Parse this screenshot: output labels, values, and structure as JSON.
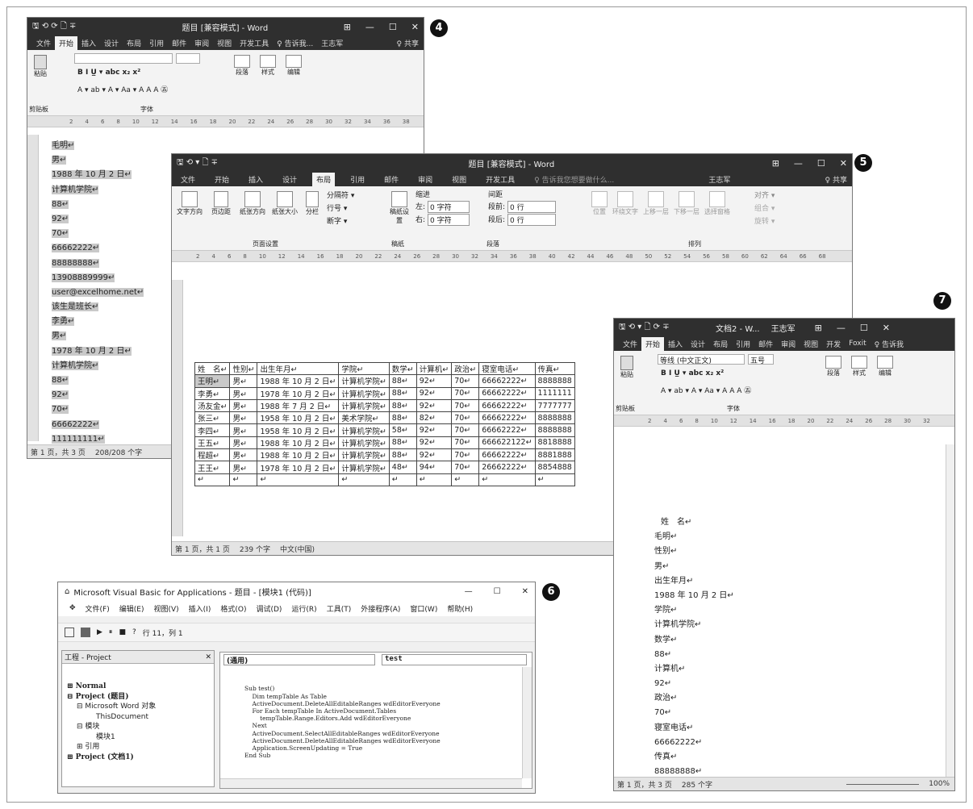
{
  "badges": {
    "b4": "4",
    "b5": "5",
    "b6": "6",
    "b7": "7"
  },
  "win4": {
    "qat": "🖫 ⟲ ⟳ 🗋 ∓",
    "title": "题目 [兼容模式] - Word",
    "controls": [
      "⊞",
      "—",
      "☐",
      "✕"
    ],
    "tabs": [
      "文件",
      "开始",
      "插入",
      "设计",
      "布局",
      "引用",
      "邮件",
      "审阅",
      "视图",
      "开发工具"
    ],
    "tell": "♀ 告诉我...",
    "user": "王志军",
    "share": "♀ 共享",
    "paste": "粘贴",
    "font_row": "B  I  U̲ ▾ abc  x₂  x²",
    "font_row2": "A ▾ ab ▾ A ▾ Aa ▾  A  A  A  ㊄",
    "para": "段落",
    "styles": "样式",
    "edit": "编辑",
    "clipboard": "剪贴板",
    "font": "字体",
    "ruler": [
      "2",
      "4",
      "6",
      "8",
      "10",
      "12",
      "14",
      "16",
      "18",
      "20",
      "22",
      "24",
      "26",
      "28",
      "30",
      "32",
      "34",
      "36",
      "38"
    ],
    "lines": [
      "毛明↵",
      "男↵",
      "1988 年 10 月 2 日↵",
      "计算机学院↵",
      "88↵",
      "92↵",
      "70↵",
      "66662222↵",
      "88888888↵",
      "13908889999↵",
      "user@excelhome.net↵",
      "该生是班长↵",
      "李勇↵",
      "男↵",
      "1978 年 10 月 2 日↵",
      "计算机学院↵",
      "88↵",
      "92↵",
      "70↵",
      "66662222↵",
      "111111111↵"
    ],
    "status": [
      "第 1 页，共 3 页",
      "208/208 个字"
    ]
  },
  "win5": {
    "qat": "🖫 ⟲ ▾   🗋   ∓",
    "title": "题目 [兼容模式] - Word",
    "controls": [
      "⊞",
      "—",
      "☐",
      "✕"
    ],
    "tabs": [
      "文件",
      "开始",
      "插入",
      "设计",
      "布局",
      "引用",
      "邮件",
      "审阅",
      "视图",
      "开发工具"
    ],
    "tell": "♀ 告诉我您想要做什么...",
    "user": "王志军",
    "share": "♀ 共享",
    "page_btns": [
      "文字方向",
      "页边距",
      "纸张方向",
      "纸张大小",
      "分栏"
    ],
    "page_small": [
      "分隔符 ▾",
      "行号 ▾",
      "断字 ▾"
    ],
    "gaozhi": "稿纸设置",
    "indent": "缩进",
    "spacing": "间距",
    "left": "左:",
    "left_val": "0 字符",
    "right": "右:",
    "right_val": "0 字符",
    "before": "段前:",
    "before_val": "0 行",
    "after": "段后:",
    "after_val": "0 行",
    "arrange": [
      "位置",
      "环绕文字",
      "上移一层",
      "下移一层",
      "选择窗格"
    ],
    "align": [
      "对齐 ▾",
      "组合 ▾",
      "旋转 ▾"
    ],
    "groups": [
      "页面设置",
      "稿纸",
      "段落",
      "排列"
    ],
    "ruler": [
      "2",
      "4",
      "6",
      "8",
      "10",
      "12",
      "14",
      "16",
      "18",
      "20",
      "22",
      "24",
      "26",
      "28",
      "30",
      "32",
      "34",
      "36",
      "38",
      "40",
      "42",
      "44",
      "46",
      "48",
      "50",
      "52",
      "54",
      "56",
      "58",
      "60",
      "62",
      "64",
      "66",
      "68"
    ],
    "headers": [
      "姓　名↵",
      "性别↵",
      "出生年月↵",
      "学院↵",
      "数学↵",
      "计算机↵",
      "政治↵",
      "寝室电话↵",
      "传真↵"
    ],
    "rows": [
      [
        "王明↵",
        "男↵",
        "1988 年 10 月 2 日↵",
        "计算机学院↵",
        "88↵",
        "92↵",
        "70↵",
        "66662222↵",
        "8888888"
      ],
      [
        "李勇↵",
        "男↵",
        "1978 年 10 月 2 日↵",
        "计算机学院↵",
        "88↵",
        "92↵",
        "70↵",
        "66662222↵",
        "1111111"
      ],
      [
        "汤友金↵",
        "男↵",
        "1988 年 7 月 2 日↵",
        "计算机学院↵",
        "88↵",
        "92↵",
        "70↵",
        "66662222↵",
        "7777777"
      ],
      [
        "张三↵",
        "男↵",
        "1958 年 10 月 2 日↵",
        "美术学院↵",
        "88↵",
        "82↵",
        "70↵",
        "66662222↵",
        "8888888"
      ],
      [
        "李四↵",
        "男↵",
        "1958 年 10 月 2 日↵",
        "计算机学院↵",
        "58↵",
        "92↵",
        "70↵",
        "66662222↵",
        "8888888"
      ],
      [
        "王五↵",
        "男↵",
        "1988 年 10 月 2 日↵",
        "计算机学院↵",
        "88↵",
        "92↵",
        "70↵",
        "666622122↵",
        "8818888"
      ],
      [
        "程超↵",
        "男↵",
        "1988 年 10 月 2 日↵",
        "计算机学院↵",
        "88↵",
        "92↵",
        "70↵",
        "66662222↵",
        "8881888"
      ],
      [
        "王王↵",
        "男↵",
        "1978 年 10 月 2 日↵",
        "计算机学院↵",
        "48↵",
        "94↵",
        "70↵",
        "26662222↵",
        "8854888"
      ],
      [
        "↵",
        "↵",
        "↵",
        "↵",
        "↵",
        "↵",
        "↵",
        "↵",
        "↵"
      ]
    ],
    "status": [
      "第 1 页，共 1 页",
      "239 个字",
      "中文(中国)"
    ]
  },
  "win6": {
    "title": "Microsoft Visual Basic for Applications - 题目 - [模块1 (代码)]",
    "controls": [
      "—",
      "☐",
      "✕"
    ],
    "menu": [
      "文件(F)",
      "编辑(E)",
      "视图(V)",
      "插入(I)",
      "格式(O)",
      "调试(D)",
      "运行(R)",
      "工具(T)",
      "外接程序(A)",
      "窗口(W)",
      "帮助(H)"
    ],
    "pos": "行 11，列 1",
    "project_title": "工程 - Project",
    "tree": [
      "⊞ Normal",
      "⊟ Project (题目)",
      "⊟ Microsoft Word 对象",
      "ThisDocument",
      "⊟ 模块",
      "模块1",
      "⊞ 引用",
      "⊞ Project (文档1)"
    ],
    "combo_left": "(通用)",
    "combo_right": "test",
    "code": [
      "Sub test()",
      "    Dim tempTable As Table",
      "    ActiveDocument.DeleteAllEditableRanges wdEditorEveryone",
      "    For Each tempTable In ActiveDocument.Tables",
      "        tempTable.Range.Editors.Add wdEditorEveryone",
      "    Next",
      "    ActiveDocument.SelectAllEditableRanges wdEditorEveryone",
      "    ActiveDocument.DeleteAllEditableRanges wdEditorEveryone",
      "    Application.ScreenUpdating = True",
      "End Sub"
    ]
  },
  "win7": {
    "qat": "🖫 ⟲ ▾   🗋 ⟳ ∓",
    "title": "文档2 - W...",
    "user": "王志军",
    "controls": [
      "⊞",
      "—",
      "☐",
      "✕"
    ],
    "tabs": [
      "文件",
      "开始",
      "插入",
      "设计",
      "布局",
      "引用",
      "邮件",
      "审阅",
      "视图",
      "开发",
      "Foxit"
    ],
    "tell": "♀ 告诉我",
    "font_name": "等线 (中文正文)",
    "font_size": "五号",
    "paste": "粘贴",
    "para": "段落",
    "styles": "样式",
    "edit": "编辑",
    "clipboard": "剪贴板",
    "font": "字体",
    "ruler": [
      "2",
      "4",
      "6",
      "8",
      "10",
      "12",
      "14",
      "16",
      "18",
      "20",
      "22",
      "24",
      "26",
      "28",
      "30",
      "32"
    ],
    "lines": [
      "姓　名↵",
      "毛明↵",
      "性别↵",
      "男↵",
      "出生年月↵",
      "1988 年 10 月 2 日↵",
      "学院↵",
      "计算机学院↵",
      "数学↵",
      "88↵",
      "计算机↵",
      "92↵",
      "政治↵",
      "70↵",
      "寝室电话↵",
      "66662222↵",
      "传真↵",
      "88888888↵"
    ],
    "status": [
      "第 1 页，共 3 页",
      "285 个字"
    ],
    "zoom": "100%"
  }
}
